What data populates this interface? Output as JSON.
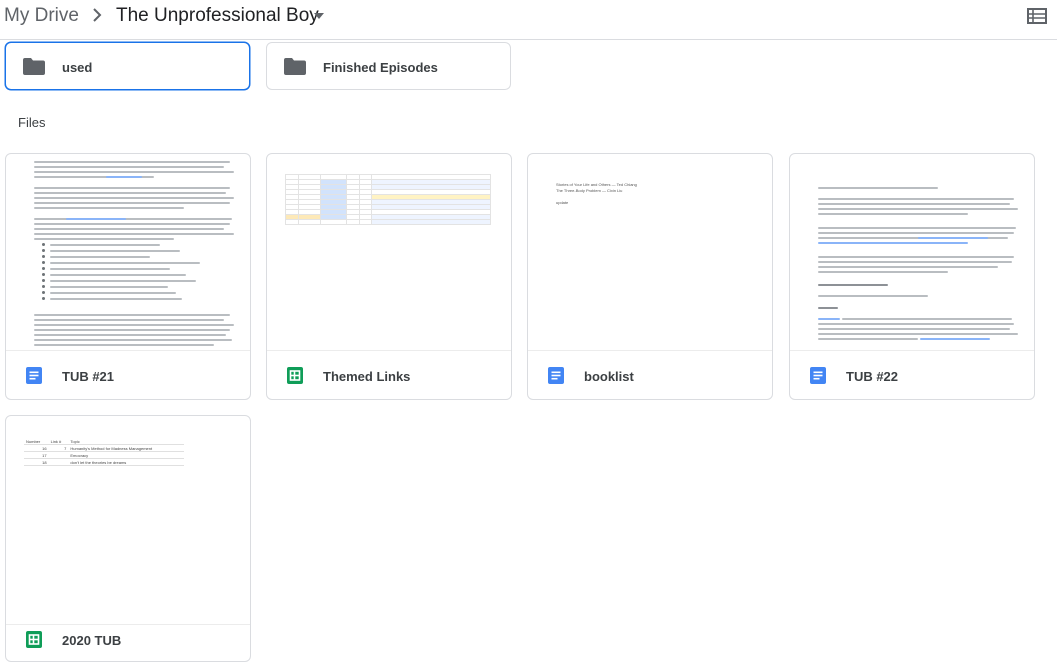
{
  "breadcrumb": {
    "root": "My Drive",
    "separator_icon": "chevron-right-icon",
    "current": "The Unprofessional Boy",
    "dropdown_icon": "caret-down-icon"
  },
  "toolbar": {
    "view_toggle_icon": "list-view-icon"
  },
  "folders": [
    {
      "name": "used",
      "icon": "folder-icon",
      "selected": true
    },
    {
      "name": "Finished Episodes",
      "icon": "folder-icon",
      "selected": false
    }
  ],
  "files_section": {
    "label": "Files"
  },
  "files": [
    {
      "name": "TUB #21",
      "type": "doc",
      "icon": "google-docs-icon"
    },
    {
      "name": "Themed Links",
      "type": "sheet",
      "icon": "google-sheets-icon"
    },
    {
      "name": "booklist",
      "type": "doc",
      "icon": "google-docs-icon"
    },
    {
      "name": "TUB #22",
      "type": "doc",
      "icon": "google-docs-icon"
    },
    {
      "name": "2020 TUB",
      "type": "sheet",
      "icon": "google-sheets-icon"
    }
  ],
  "previews": {
    "booklist": {
      "line1": "Stories of Your Life and Others — Ted Chiang",
      "line2": "The Three-Body Problem — Cixin Liu",
      "line3": "update"
    },
    "tub2020": {
      "headers": [
        "Number",
        "Link #",
        "Topic"
      ],
      "rows": [
        [
          "16",
          "7",
          "Humanity's Method for Madness Management"
        ],
        [
          "17",
          "",
          "Emocracy"
        ],
        [
          "18",
          "",
          "don't let the theories be dreams"
        ]
      ]
    }
  },
  "colors": {
    "docs_blue": "#4285f4",
    "sheets_green": "#0f9d58",
    "folder_gray": "#5f6368",
    "selection_blue": "#1a73e8"
  }
}
